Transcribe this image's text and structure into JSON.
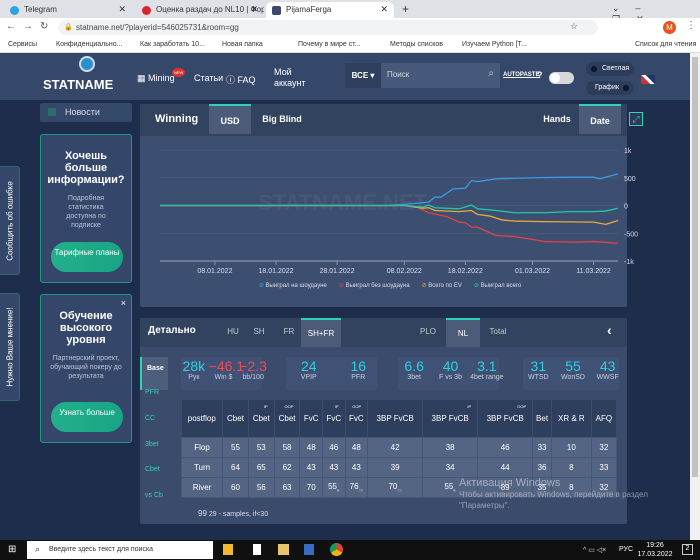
{
  "browser": {
    "tabs": [
      {
        "title": "Telegram",
        "color": "#2aa3e0"
      },
      {
        "title": "Оценка раздач до NL10 | Форум",
        "color": "#d9262c"
      },
      {
        "title": "PijamaFerga",
        "color": "#3b4a6b"
      }
    ],
    "url": "statname.net/?playerid=546025731&room=gg",
    "bookmarks": [
      "Сервисы",
      "Конфиденциально...",
      "Как заработать 10...",
      "Новая папка",
      "Почему в мире ст...",
      "Методы списков",
      "Изучаем Python [T...",
      "Список для чтения"
    ],
    "profile_initial": "M"
  },
  "header": {
    "logo": "STATNAME",
    "nav": [
      "Mining",
      "Статьи",
      "FAQ",
      "Мой аккаунт"
    ],
    "new_badge": "NEW",
    "filter": "ВСЕ",
    "search_placeholder": "Поиск",
    "autopaste": "AUTOPASTE",
    "help": "?",
    "theme_light": "Светлая",
    "theme_chart": "График",
    "autopaste_on": false
  },
  "sidebar": {
    "news": "Новости",
    "report_bug": "Сообщить об ошибке",
    "feedback": "Нужно Ваше мнение!",
    "card1": {
      "title": "Хочешь больше информации?",
      "text": "Подробная статистика доступна по подписке",
      "button": "Тарифные планы"
    },
    "card2": {
      "title": "Обучение высокого уровня",
      "text": "Партнерский проект, обучающий покеру до результата",
      "button": "Узнать больше",
      "close": "×"
    }
  },
  "winning": {
    "title": "Winning",
    "tabs": [
      "USD",
      "Big Blind"
    ],
    "active_tab": "USD",
    "x_modes": [
      "Hands",
      "Date"
    ],
    "active_mode": "Date",
    "watermark": "STATNAME.NET"
  },
  "chart_data": {
    "type": "line",
    "ylim": [
      -1000,
      1000
    ],
    "yticks": [
      1000,
      500,
      0,
      -500,
      -1000
    ],
    "ytick_labels": [
      "1k",
      "500",
      "0",
      "-500",
      "-1k"
    ],
    "xlim": [
      "30.12.2021",
      "15.03.2022"
    ],
    "xticks": [
      "08.01.2022",
      "18.01.2022",
      "28.01.2022",
      "08.02.2022",
      "18.02.2022",
      "01.03.2022",
      "11.03.2022"
    ],
    "grid": true,
    "legend": "bottom",
    "series": [
      {
        "name": "Выиграл на шоудауне",
        "color": "#3b9be8",
        "points": [
          [
            "30.12.2021",
            0
          ],
          [
            "05.02.2022",
            0
          ],
          [
            "08.02.2022",
            20
          ],
          [
            "12.02.2022",
            60
          ],
          [
            "13.02.2022",
            150
          ],
          [
            "14.02.2022",
            150
          ],
          [
            "16.02.2022",
            300
          ],
          [
            "18.02.2022",
            310
          ],
          [
            "19.02.2022",
            450
          ],
          [
            "20.02.2022",
            430
          ],
          [
            "23.02.2022",
            480
          ],
          [
            "01.03.2022",
            500
          ],
          [
            "07.03.2022",
            510
          ],
          [
            "11.03.2022",
            510
          ],
          [
            "12.03.2022",
            480
          ],
          [
            "15.03.2022",
            570
          ]
        ]
      },
      {
        "name": "Выиграл без шоудауна",
        "color": "#e0424c",
        "points": [
          [
            "30.12.2021",
            0
          ],
          [
            "08.02.2022",
            0
          ],
          [
            "10.02.2022",
            -20
          ],
          [
            "12.02.2022",
            -130
          ],
          [
            "15.02.2022",
            -200
          ],
          [
            "17.02.2022",
            -300
          ],
          [
            "18.02.2022",
            -310
          ],
          [
            "19.02.2022",
            -390
          ],
          [
            "20.02.2022",
            -390
          ],
          [
            "23.02.2022",
            -540
          ],
          [
            "26.02.2022",
            -560
          ],
          [
            "01.03.2022",
            -610
          ],
          [
            "03.03.2022",
            -650
          ],
          [
            "08.03.2022",
            -660
          ],
          [
            "11.03.2022",
            -650
          ],
          [
            "15.03.2022",
            -680
          ]
        ]
      },
      {
        "name": "Всего по EV",
        "color": "#e8a93a",
        "points": [
          [
            "30.12.2021",
            0
          ],
          [
            "08.02.2022",
            0
          ],
          [
            "11.02.2022",
            -50
          ],
          [
            "12.02.2022",
            -40
          ],
          [
            "13.02.2022",
            -90
          ],
          [
            "17.02.2022",
            -110
          ],
          [
            "19.02.2022",
            -90
          ],
          [
            "20.02.2022",
            -160
          ],
          [
            "22.02.2022",
            -190
          ],
          [
            "24.02.2022",
            -260
          ],
          [
            "26.02.2022",
            -280
          ],
          [
            "03.03.2022",
            -290
          ],
          [
            "11.03.2022",
            -300
          ],
          [
            "13.03.2022",
            -340
          ],
          [
            "15.03.2022",
            -270
          ]
        ]
      },
      {
        "name": "Выиграл всего",
        "color": "#22c7a9",
        "points": [
          [
            "30.12.2021",
            0
          ],
          [
            "08.02.2022",
            0
          ],
          [
            "11.02.2022",
            -30
          ],
          [
            "12.02.2022",
            10
          ],
          [
            "13.02.2022",
            -40
          ],
          [
            "17.02.2022",
            -60
          ],
          [
            "19.02.2022",
            10
          ],
          [
            "20.02.2022",
            -60
          ],
          [
            "23.02.2022",
            -90
          ],
          [
            "26.02.2022",
            -130
          ],
          [
            "03.03.2022",
            -130
          ],
          [
            "07.03.2022",
            -110
          ],
          [
            "11.03.2022",
            -110
          ],
          [
            "13.03.2022",
            -100
          ],
          [
            "15.03.2022",
            -50
          ]
        ]
      }
    ]
  },
  "detail": {
    "title": "Детально",
    "tabs": [
      "HU",
      "SH",
      "FR",
      "SH+FR"
    ],
    "active_tab": "SH+FR",
    "game_tabs": [
      "PLO",
      "NL",
      "Total"
    ],
    "active_game": "NL",
    "side_tabs": [
      "Base",
      "PFR",
      "CC",
      "3bet",
      "Cbet",
      "vs Cb"
    ],
    "active_side": "Base",
    "stat_groups": [
      [
        {
          "v": "28k",
          "l": "Рук"
        },
        {
          "v": "−46.1",
          "l": "Win $",
          "neg": true
        },
        {
          "v": "−2.3",
          "l": "bb/100",
          "neg": true
        }
      ],
      [
        {
          "v": "24",
          "l": "VPIP"
        },
        {
          "v": "16",
          "l": "PFR"
        }
      ],
      [
        {
          "v": "6.6",
          "l": "3bet"
        },
        {
          "v": "40",
          "l": "F vs 3b"
        },
        {
          "v": "3.1",
          "l": "4bet range"
        }
      ],
      [
        {
          "v": "31",
          "l": "WTSD"
        },
        {
          "v": "55",
          "l": "WonSD"
        },
        {
          "v": "43",
          "l": "WWSF"
        }
      ]
    ],
    "columns": [
      {
        "h": "postflop"
      },
      {
        "h": "Cbet"
      },
      {
        "h": "Cbet",
        "sup": "IP"
      },
      {
        "h": "Cbet",
        "sup": "OOP"
      },
      {
        "h": "FvC"
      },
      {
        "h": "FvC",
        "sup": "IP"
      },
      {
        "h": "FvC",
        "sup": "OOP"
      },
      {
        "h": "3BP FvCB"
      },
      {
        "h": "3BP FvCB",
        "sup": "IP"
      },
      {
        "h": "3BP FvCB",
        "sup": "OOP"
      },
      {
        "h": "Bet"
      },
      {
        "h": "XR & R"
      },
      {
        "h": "AFQ"
      }
    ],
    "rows": [
      {
        "cells": [
          "Flop",
          "55",
          "53",
          "58",
          "48",
          "46",
          "48",
          "42",
          "38",
          "46",
          "33",
          "10",
          "32"
        ],
        "samples": [
          "",
          "",
          "",
          "",
          "",
          "",
          "",
          "",
          "",
          "",
          "",
          "",
          ""
        ]
      },
      {
        "cells": [
          "Turn",
          "64",
          "65",
          "62",
          "43",
          "43",
          "43",
          "39",
          "34",
          "44",
          "36",
          "8",
          "33"
        ],
        "samples": [
          "",
          "",
          "",
          "",
          "",
          "",
          "",
          "",
          "",
          "",
          "",
          "",
          ""
        ]
      },
      {
        "cells": [
          "River",
          "60",
          "56",
          "63",
          "70",
          "55",
          "76",
          "70",
          "55",
          "89",
          "35",
          "8",
          "32"
        ],
        "samples": [
          "",
          "",
          "",
          "",
          "",
          "■",
          "29",
          "20",
          "■",
          "",
          "",
          "",
          ""
        ]
      }
    ],
    "footnote_num": "99",
    "footnote_sub": "29",
    "footnote": "- samples, if<30"
  },
  "watermark_os": {
    "title": "Активация Windows",
    "text": "Чтобы активировать Windows, перейдите в раздел \"Параметры\"."
  },
  "taskbar": {
    "search_placeholder": "Введите здесь текст для поиска",
    "time": "19:26",
    "date": "17.03.2022",
    "lang": "РУС",
    "notifications": "2"
  }
}
